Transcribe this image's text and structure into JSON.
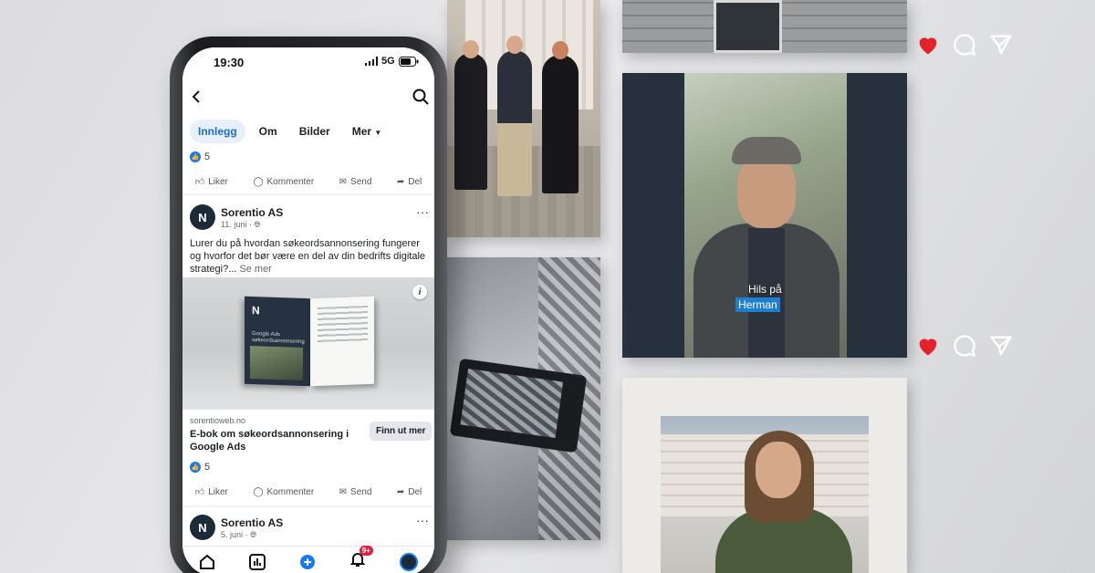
{
  "status": {
    "time": "19:30",
    "network": "5G"
  },
  "tabs": [
    {
      "label": "Innlegg",
      "active": true
    },
    {
      "label": "Om"
    },
    {
      "label": "Bilder"
    },
    {
      "label": "Mer"
    }
  ],
  "previous_post": {
    "reaction_count": "5"
  },
  "actions": {
    "like": "Liker",
    "comment": "Kommenter",
    "send": "Send",
    "share": "Del"
  },
  "post": {
    "author": "Sorentio AS",
    "date": "11. juni",
    "text": "Lurer du på hvordan søkeordsannonsering fungerer og hvorfor det bør være en del av din bedrifts digitale strategi?...",
    "see_more": "Se mer",
    "book": {
      "logo": "N",
      "cover_title": "Google Ads søkeordsannonsering"
    },
    "link_domain": "sorentioweb.no",
    "link_title": "E-bok om søkeordsannonsering i Google Ads",
    "cta_label": "Finn ut mer",
    "reaction_count": "5"
  },
  "next_post": {
    "author": "Sorentio AS",
    "date": "5. juni"
  },
  "nav": {
    "notification_badge": "9+"
  },
  "reel": {
    "caption_line1": "Hils på",
    "caption_line2": "Herman"
  },
  "colors": {
    "brand_blue": "#1877f2",
    "heart_red": "#e4222b",
    "avatar_navy": "#1d2a38"
  }
}
